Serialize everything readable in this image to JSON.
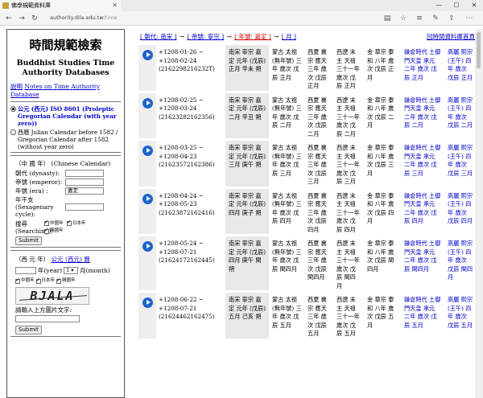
{
  "browser": {
    "tab_title": "佛學規範資料庫",
    "tab_close": "✕",
    "url_host": "authority.dila.edu.tw",
    "url_path": "/time",
    "back": "←",
    "forward": "→",
    "reload": "↻",
    "minimize": "—",
    "maximize": "☐",
    "close": "✕"
  },
  "sidebar": {
    "title": "時間規範檢索",
    "subtitle": "Buddhist Studies Time Authority Databases",
    "desc_prefix": "說明",
    "desc_link": "Notes on Time Authority Database",
    "calendar_options": [
      {
        "label_zh": "公元 (西元)",
        "label_std": "ISO 8601",
        "label_en": "(Proleptic Gregorian Calendar (with year zero))",
        "selected": true
      },
      {
        "label": "西曆 Julian Calendar before 1582 / Gregorian Calendar after 1582 (without year zero)",
        "selected": false
      }
    ],
    "chinese_head": "（中 國 年）",
    "chinese_head_en": "(Chinese Calendar)",
    "fields": [
      {
        "label": "朝代 (dynasty):",
        "value": ""
      },
      {
        "label": "帝號 (emperor):",
        "value": ""
      },
      {
        "label": "年號 (era) :",
        "value": "嘉定"
      },
      {
        "label": "年干支 (Sexagenary cycle):",
        "value": ""
      }
    ],
    "search_label": "搜尋 (Searching):",
    "search_checks": [
      {
        "label": "中國年",
        "checked": true
      },
      {
        "label": "日本年",
        "checked": true
      },
      {
        "label": "韓國年",
        "checked": true
      }
    ],
    "submit1": "Submit",
    "western_head": "（西 元 年）",
    "western_link": "公元 (西元) 曆",
    "year_label": "年(year)",
    "month_value": "1",
    "month_label": "月(month)",
    "western_checks": [
      {
        "label": "中國年",
        "checked": true
      },
      {
        "label": "日本年",
        "checked": true
      },
      {
        "label": "韓國年",
        "checked": true
      }
    ],
    "captcha_text": "BJALA",
    "captcha_prompt": "請輸入上方圖片文字:",
    "submit2": "Submit"
  },
  "main": {
    "crumbs": [
      "[ 朝代: 南宋 ]",
      "[ 帝號: 寧宗 ]",
      "[ 年號: 嘉定 ]",
      "[ 月 ]"
    ],
    "crumb_arrow": "→",
    "crumb_right": "回時間資料庫首頁",
    "rows": [
      {
        "date": "+1208-01-26 ~ +1208-02-24 (2162298216232T)",
        "song": "南宋 寧宗 嘉定 元年 (戊辰) 正月 辛未 朔",
        "meng": "蒙古 太祖 (無年號) 三年 歲次 戊辰 正月",
        "xixia": "西夏 襄宗 應天 三年 歲次 戊辰 正月",
        "dali": "西遼 末主 天禧 三十一年 歲次 戊辰 正月",
        "jin": "金 章宗 泰和 八年 歲次 戊辰 正月",
        "jp": "鎌倉時代 土御門天皇 承元 二年 歲次 戊辰 正月",
        "kor": "高麗 熙宗 (王午) 四年 歲次 戊辰 正月"
      },
      {
        "date": "+1208-02-25 ~ +1208-03-24 (21623282162356)",
        "song": "南宋 寧宗 嘉定 元年 (戊辰) 二月 辛丑 朔",
        "meng": "蒙古 太祖 (無年號) 三年 歲次 戊辰 二月",
        "xixia": "西夏 襄宗 應天 三年 歲次 戊辰 二月",
        "dali": "西遼 末主 天禧 三十一年 歲次 戊辰 二月",
        "jin": "金 章宗 泰和 八年 歲次 戊辰 二月",
        "jp": "鎌倉時代 土御門天皇 承元 二年 歲次 戊辰 二月",
        "kor": "高麗 熙宗 (王午) 四年 歲次 戊辰 二月"
      },
      {
        "date": "+1208-03-25 ~ +1208-04-23 (21623572162386)",
        "song": "南宋 寧宗 嘉定 元年 (戊辰) 三月 庚午 朔",
        "meng": "蒙古 太祖 (無年號) 三年 歲次 戊辰 三月",
        "xixia": "西夏 襄宗 應天 三年 歲次 戊辰 三月",
        "dali": "西遼 末主 天禧 三十一年 歲次 戊辰 三月",
        "jin": "金 章宗 泰和 八年 歲次 戊辰 三月",
        "jp": "鎌倉時代 土御門天皇 承元 二年 歲次 戊辰 三月",
        "kor": "高麗 熙宗 (王午) 四年 歲次 戊辰 三月"
      },
      {
        "date": "+1208-04-24 ~ +1208-05-23 (21623872162416)",
        "song": "南宋 寧宗 嘉定 元年 (戊辰) 四月 庚子 朔",
        "meng": "蒙古 太祖 (無年號) 三年 歲次 戊辰 四月",
        "xixia": "西夏 襄宗 應天 三年 歲次 戊辰 四月",
        "dali": "西遼 末主 天禧 三十一年 歲次 戊辰 四月",
        "jin": "金 章宗 泰和 八年 歲次 戊辰 四月",
        "jp": "鎌倉時代 土御門天皇 承元 二年 歲次 戊辰 四月",
        "kor": "高麗 熙宗 (王午) 四年 歲次 戊辰 四月"
      },
      {
        "date": "+1208-05-24 ~ +1208-07-21 (21624172162445)",
        "song": "南宋 寧宗 嘉定 元年 (戊辰) 四月 庚午 閏 朔",
        "meng": "蒙古 太祖 (無年號) 三年 歲次 戊辰 閏四月",
        "xixia": "西夏 襄宗 應天 三年 歲次 戊辰 閏四月",
        "dali": "西遼 末主 天禧 三十一年 歲次 戊辰 閏四月",
        "jin": "金 章宗 泰和 八年 歲次 戊辰 閏四月",
        "jp": "鎌倉時代 土御門天皇 承元 二年 歲次 戊辰 閏四月",
        "kor": "高麗 熙宗 (王午) 四年 歲次 戊辰 閏四月"
      },
      {
        "date": "+1208-06-22 ~ +1208-07-21 (21624462162475)",
        "song": "南宋 寧宗 嘉定 元年 (戊辰) 五月 己亥 朔",
        "meng": "蒙古 太祖 (無年號) 三年 歲次 戊辰 五月",
        "xixia": "西夏 襄宗 應天 三年 歲次 戊辰 五月",
        "dali": "西遼 末主 天禧 三十一年 歲次 戊辰 五月",
        "jin": "金 章宗 泰和 八年 歲次 戊辰 五月",
        "jp": "鎌倉時代 土御門天皇 承元 二年 歲次 戊辰 五月",
        "kor": "高麗 熙宗 (王午) 四年 歲次 戊辰 五月"
      }
    ]
  }
}
